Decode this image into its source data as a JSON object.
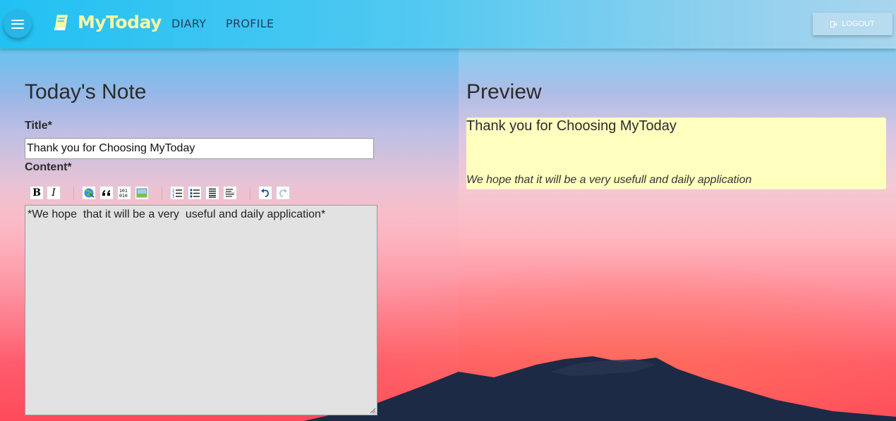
{
  "app": {
    "brand": "MyToday",
    "nav": {
      "diary": "DIARY",
      "profile": "PROFILE"
    },
    "logout_label": "LOGOUT"
  },
  "editor": {
    "heading": "Today's Note",
    "title_label": "Title*",
    "title_value": "Thank you for Choosing MyToday",
    "content_label": "Content*",
    "content_value": "*We hope  that it will be a very  useful and daily application*",
    "toolbar": {
      "bold": "B",
      "italic": "I"
    }
  },
  "preview": {
    "heading": "Preview",
    "title": "Thank you for Choosing MyToday",
    "body": "We hope that it will be a very usefull and daily application"
  },
  "colors": {
    "navbar": "#22c1f3",
    "brand": "#f6f9a8",
    "preview_bg": "#ffffc0",
    "editor_bg": "#e2e2e2"
  }
}
